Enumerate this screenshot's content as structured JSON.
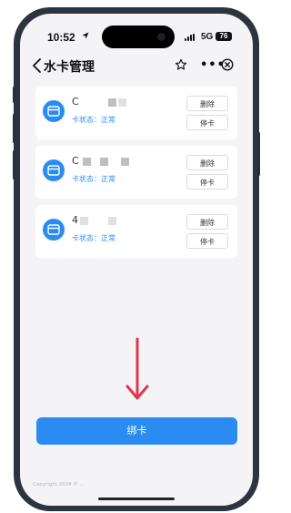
{
  "status_bar": {
    "time": "10:52",
    "network": "5G",
    "battery": "76"
  },
  "nav": {
    "title": "水卡管理"
  },
  "cards": [
    {
      "id_prefix": "C",
      "status": "卡状态：正常",
      "delete_label": "删除",
      "suspend_label": "停卡"
    },
    {
      "id_prefix": "C",
      "status": "卡状态：正常",
      "delete_label": "删除",
      "suspend_label": "停卡"
    },
    {
      "id_prefix": "4",
      "status": "卡状态：正常",
      "delete_label": "删除",
      "suspend_label": "停卡"
    }
  ],
  "bind_button": {
    "label": "绑卡"
  },
  "footer": {
    "copyright": "Copyright 2024 © ..."
  },
  "colors": {
    "accent": "#2a8cf3",
    "arrow": "#e2374a",
    "status_text": "#2a8cf3"
  },
  "icons": [
    "location-arrow-icon",
    "back-chevron-icon",
    "star-icon",
    "more-icon",
    "close-circle-icon",
    "card-icon",
    "annotation-arrow-icon"
  ]
}
